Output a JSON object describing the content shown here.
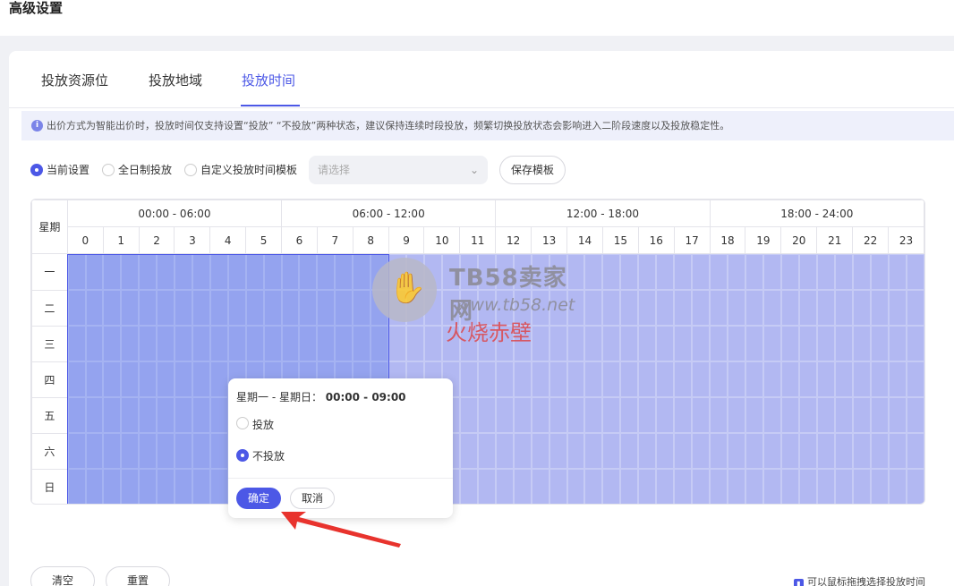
{
  "page_title": "高级设置",
  "tabs": [
    {
      "label": "投放资源位",
      "active": false
    },
    {
      "label": "投放地域",
      "active": false
    },
    {
      "label": "投放时间",
      "active": true
    }
  ],
  "notice": {
    "text": "出价方式为智能出价时，投放时间仅支持设置“投放” “不投放”两种状态，建议保持连续时段投放，频繁切换投放状态会影响进入二阶段速度以及投放稳定性。"
  },
  "options": {
    "current": "当前设置",
    "all_day": "全日制投放",
    "custom_template": "自定义投放时间模板",
    "select_placeholder": "请选择",
    "save_template": "保存模板"
  },
  "grid": {
    "day_header": "星期",
    "hour_groups": [
      "00:00 - 06:00",
      "06:00 - 12:00",
      "12:00 - 18:00",
      "18:00 - 24:00"
    ],
    "hours": [
      "0",
      "1",
      "2",
      "3",
      "4",
      "5",
      "6",
      "7",
      "8",
      "9",
      "10",
      "11",
      "12",
      "13",
      "14",
      "15",
      "16",
      "17",
      "18",
      "19",
      "20",
      "21",
      "22",
      "23"
    ],
    "days": [
      "一",
      "二",
      "三",
      "四",
      "五",
      "六",
      "日"
    ],
    "selected_hours": 9
  },
  "watermark": {
    "line1": "TB58卖家网",
    "line2": "www.tb58.net",
    "line3": "火烧赤壁"
  },
  "popover": {
    "range_label": "星期一 - 星期日：",
    "range_time": "00:00 - 09:00",
    "option_on": "投放",
    "option_off": "不投放",
    "ok": "确定",
    "cancel": "取消"
  },
  "footer": {
    "clear": "清空",
    "reset": "重置",
    "hint": "可以鼠标拖拽选择投放时间"
  },
  "colors": {
    "accent": "#4c58e6",
    "slot": "#b2b8f2",
    "slot_selected": "#94a3ef"
  }
}
